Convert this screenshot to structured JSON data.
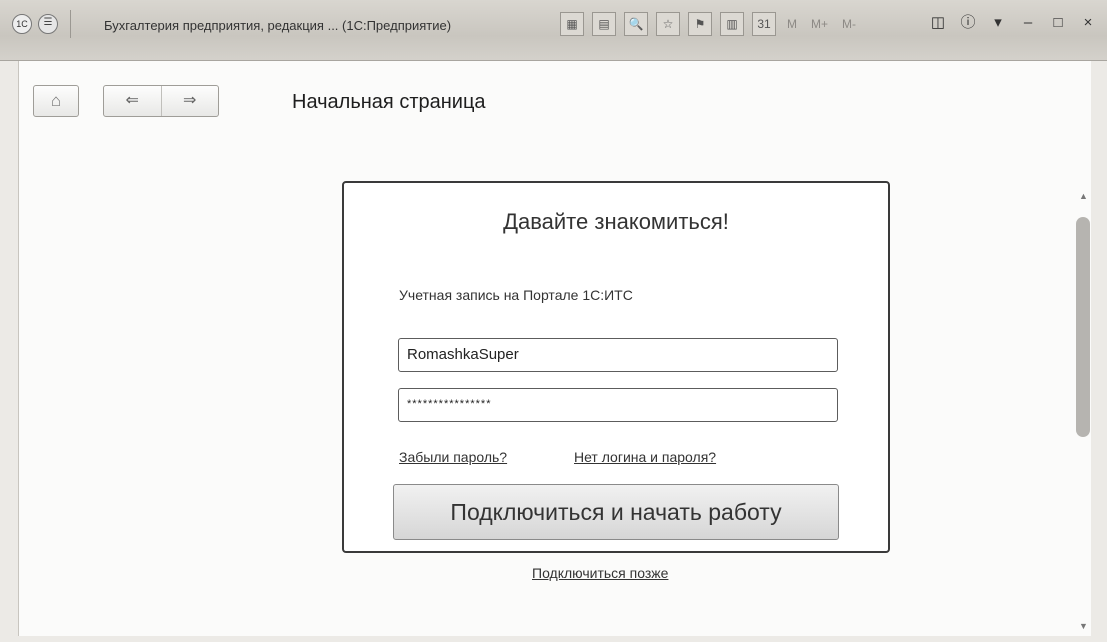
{
  "titlebar": {
    "logo": "1С",
    "menu_glyph": "☰",
    "title": "Бухгалтерия предприятия, редакция ... (1С:Предприятие)",
    "tool_icons": [
      "▦",
      "▤",
      "🔍",
      "☆",
      "⚑",
      "▥",
      "31"
    ],
    "mem_labels": [
      "M",
      "M+",
      "M-"
    ],
    "right_icons": [
      "◫",
      "ⓘ",
      "▾"
    ],
    "win_buttons": {
      "minimize": "–",
      "maximize": "□",
      "close": "×"
    }
  },
  "toolbar": {
    "home": "⌂",
    "back": "⇐",
    "forward": "⇒"
  },
  "page": {
    "title": "Начальная страница"
  },
  "login": {
    "title": "Давайте знакомиться!",
    "account_label": "Учетная запись на Портале 1С:ИТС",
    "login_value": "RomashkaSuper",
    "password_value": "****************",
    "forgot_link": "Забыли пароль?",
    "no_login_link": "Нет логина и пароля?",
    "connect_button": "Подключиться и начать работу",
    "later_link": "Подключиться позже"
  },
  "scrollbar": {
    "up": "▲",
    "down": "▼"
  }
}
